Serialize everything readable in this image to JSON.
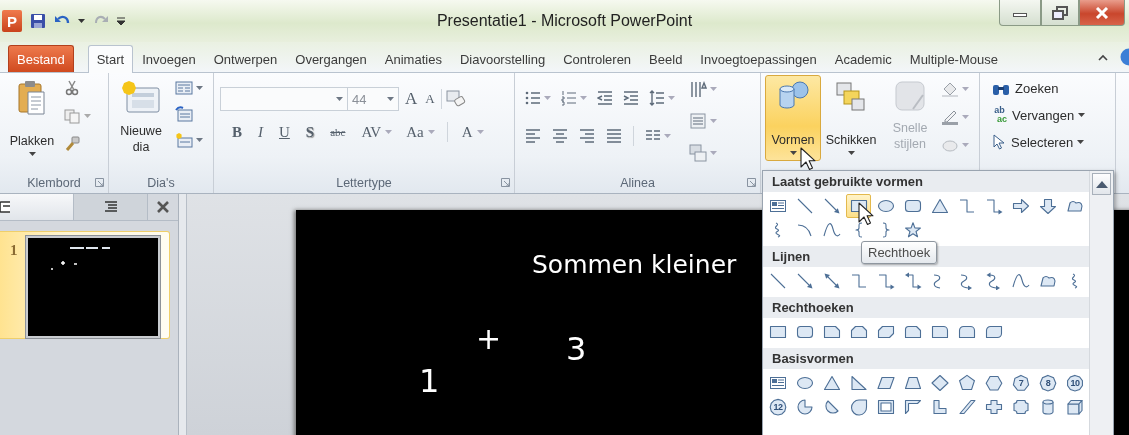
{
  "title_bar": {
    "app_logo": "P",
    "title": "Presentatie1 - Microsoft PowerPoint",
    "redo_disabled": true
  },
  "tabs": [
    {
      "label": "Bestand",
      "kind": "file",
      "selected": false
    },
    {
      "label": "Start",
      "kind": "tab",
      "selected": true
    },
    {
      "label": "Invoegen",
      "kind": "tab",
      "selected": false
    },
    {
      "label": "Ontwerpen",
      "kind": "tab",
      "selected": false
    },
    {
      "label": "Overgangen",
      "kind": "tab",
      "selected": false
    },
    {
      "label": "Animaties",
      "kind": "tab",
      "selected": false
    },
    {
      "label": "Diavoorstelling",
      "kind": "tab",
      "selected": false
    },
    {
      "label": "Controleren",
      "kind": "tab",
      "selected": false
    },
    {
      "label": "Beeld",
      "kind": "tab",
      "selected": false
    },
    {
      "label": "Invoegtoepassingen",
      "kind": "tab",
      "selected": false
    },
    {
      "label": "Academic",
      "kind": "tab",
      "selected": false
    },
    {
      "label": "Multiple-Mouse",
      "kind": "tab",
      "selected": false
    }
  ],
  "ribbon": {
    "clipboard": {
      "label": "Klembord",
      "paste": "Plakken"
    },
    "slides": {
      "label": "Dia's",
      "new_slide": "Nieuwe dia"
    },
    "font": {
      "label": "Lettertype",
      "size": "44",
      "grow": "A",
      "shrink": "A",
      "format_buttons": [
        {
          "kind": "bold",
          "label": "B",
          "dropdown": false
        },
        {
          "kind": "italic",
          "label": "I",
          "dropdown": false
        },
        {
          "kind": "underline",
          "label": "U",
          "dropdown": false
        },
        {
          "kind": "shadow",
          "label": "S",
          "dropdown": false
        },
        {
          "kind": "strikethrough",
          "label": "abc",
          "dropdown": false
        },
        {
          "kind": "spacing",
          "label": "AV",
          "dropdown": true
        },
        {
          "kind": "case",
          "label": "Aa",
          "dropdown": true
        },
        {
          "kind": "color",
          "label": "A",
          "dropdown": true
        }
      ]
    },
    "paragraph": {
      "label": "Alinea"
    },
    "drawing": {
      "shapes": {
        "label": "Vormen",
        "selected": true
      },
      "arrange": "Schikken",
      "quick_styles": {
        "label": "Snelle stijlen",
        "disabled": true
      }
    },
    "editing": {
      "find": "Zoeken",
      "replace": {
        "label": "Vervangen",
        "icon_from": "ab",
        "icon_to": "ac"
      },
      "select": "Selecteren"
    }
  },
  "slide_panel": {
    "tabs": [
      {
        "kind": "slides",
        "selected": true
      },
      {
        "kind": "outline",
        "selected": false
      }
    ],
    "slides": [
      {
        "number": "1",
        "selected": true
      }
    ]
  },
  "slide": {
    "title": "Sommen kleiner",
    "items": [
      {
        "text": "+"
      },
      {
        "text": "3"
      },
      {
        "text": "1"
      }
    ]
  },
  "shapes_gallery": {
    "tooltip": "Rechthoek",
    "sections": [
      {
        "title": "Laatst gebruikte vormen",
        "shapes": [
          {
            "kind": "text-box",
            "selected": false
          },
          {
            "kind": "line",
            "selected": false
          },
          {
            "kind": "arrow",
            "selected": false
          },
          {
            "kind": "rectangle",
            "selected": true
          },
          {
            "kind": "oval",
            "selected": false
          },
          {
            "kind": "rounded-rectangle",
            "selected": false
          },
          {
            "kind": "triangle",
            "selected": false
          },
          {
            "kind": "elbow-connector",
            "selected": false
          },
          {
            "kind": "elbow-arrow",
            "selected": false
          },
          {
            "kind": "right-arrow",
            "selected": false
          },
          {
            "kind": "down-arrow",
            "selected": false
          },
          {
            "kind": "freeform",
            "selected": false
          },
          {
            "kind": "scribble",
            "selected": false
          },
          {
            "kind": "arc",
            "selected": false
          },
          {
            "kind": "curve",
            "selected": false
          },
          {
            "kind": "left-brace",
            "selected": false
          },
          {
            "kind": "right-brace",
            "selected": false
          },
          {
            "kind": "star",
            "selected": false
          }
        ]
      },
      {
        "title": "Lijnen",
        "shapes": [
          {
            "kind": "line",
            "selected": false
          },
          {
            "kind": "arrow",
            "selected": false
          },
          {
            "kind": "double-arrow",
            "selected": false
          },
          {
            "kind": "elbow-connector",
            "selected": false
          },
          {
            "kind": "elbow-arrow",
            "selected": false
          },
          {
            "kind": "elbow-double-arrow",
            "selected": false
          },
          {
            "kind": "curved-connector",
            "selected": false
          },
          {
            "kind": "curved-arrow",
            "selected": false
          },
          {
            "kind": "curved-double-arrow",
            "selected": false
          },
          {
            "kind": "curve",
            "selected": false
          },
          {
            "kind": "freeform",
            "selected": false
          },
          {
            "kind": "scribble",
            "selected": false
          }
        ]
      },
      {
        "title": "Rechthoeken",
        "shapes": [
          {
            "kind": "rectangle",
            "selected": false
          },
          {
            "kind": "rounded-rectangle",
            "selected": false
          },
          {
            "kind": "snipped-rectangle",
            "selected": false
          },
          {
            "kind": "snipped-top-rectangle",
            "selected": false
          },
          {
            "kind": "snipped-diagonal-rectangle",
            "selected": false
          },
          {
            "kind": "snipped-rounded-rectangle",
            "selected": false
          },
          {
            "kind": "round-corner-rectangle",
            "selected": false
          },
          {
            "kind": "round-top-rectangle",
            "selected": false
          },
          {
            "kind": "round-diagonal-rectangle",
            "selected": false
          }
        ]
      },
      {
        "title": "Basisvormen",
        "shapes": [
          {
            "kind": "text-box",
            "selected": false
          },
          {
            "kind": "oval",
            "selected": false
          },
          {
            "kind": "triangle",
            "selected": false
          },
          {
            "kind": "right-triangle",
            "selected": false
          },
          {
            "kind": "parallelogram",
            "selected": false
          },
          {
            "kind": "trapezoid",
            "selected": false
          },
          {
            "kind": "diamond",
            "selected": false
          },
          {
            "kind": "pentagon",
            "selected": false
          },
          {
            "kind": "hexagon",
            "selected": false
          },
          {
            "kind": "heptagon",
            "label": "7",
            "selected": false
          },
          {
            "kind": "octagon",
            "label": "8",
            "selected": false
          },
          {
            "kind": "decagon",
            "label": "10",
            "selected": false
          },
          {
            "kind": "dodecagon",
            "label": "12",
            "selected": false
          },
          {
            "kind": "pie",
            "selected": false
          },
          {
            "kind": "chord",
            "selected": false
          },
          {
            "kind": "teardrop",
            "selected": false
          },
          {
            "kind": "frame",
            "selected": false
          },
          {
            "kind": "half-frame",
            "selected": false
          },
          {
            "kind": "l-shape",
            "selected": false
          },
          {
            "kind": "diagonal-stripe",
            "selected": false
          },
          {
            "kind": "cross",
            "selected": false
          },
          {
            "kind": "plaque",
            "selected": false
          },
          {
            "kind": "can",
            "selected": false
          },
          {
            "kind": "cube",
            "selected": false
          }
        ]
      }
    ]
  }
}
